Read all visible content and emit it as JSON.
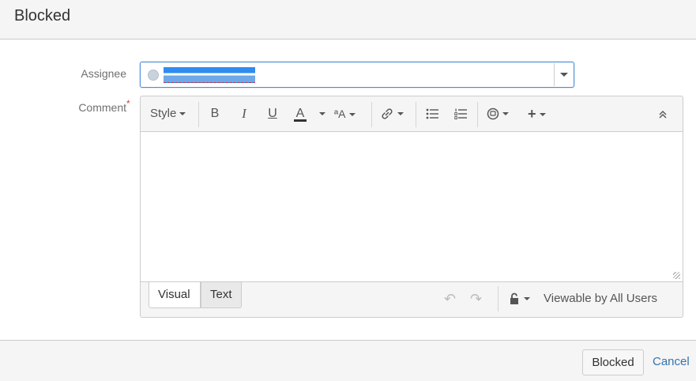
{
  "dialog": {
    "title": "Blocked"
  },
  "form": {
    "assignee_label": "Assignee",
    "comment_label": "Comment",
    "required_marker": "*"
  },
  "toolbar": {
    "style_label": "Style",
    "bold_label": "B",
    "italic_label": "I",
    "underline_label": "U",
    "color_label": "A",
    "format_label": "ªA",
    "icons": [
      "link-icon",
      "bullet-list-icon",
      "numbered-list-icon",
      "emoticon-icon",
      "insert-plus-icon",
      "collapse-toolbar-icon"
    ]
  },
  "editor": {
    "tabs": [
      "Visual",
      "Text"
    ],
    "active_tab": "Visual",
    "visibility_label": "Viewable by All Users"
  },
  "footer": {
    "submit_label": "Blocked",
    "cancel_label": "Cancel"
  },
  "colors": {
    "accent": "#3572b0",
    "required": "#d04437",
    "focus_border": "#4a90d9"
  }
}
